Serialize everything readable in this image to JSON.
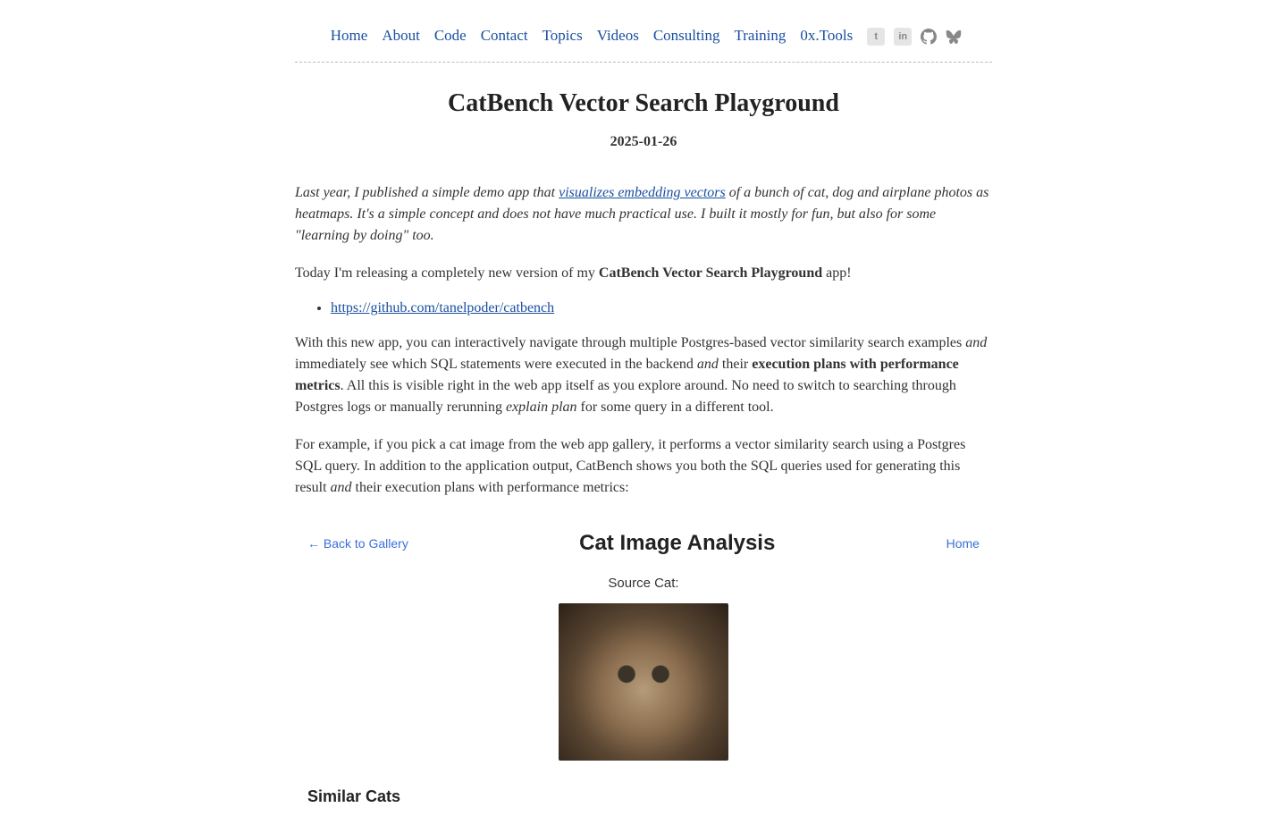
{
  "nav": {
    "items": [
      "Home",
      "About",
      "Code",
      "Contact",
      "Topics",
      "Videos",
      "Consulting",
      "Training",
      "0x.Tools"
    ]
  },
  "article": {
    "title": "CatBench Vector Search Playground",
    "date": "2025-01-26",
    "intro_pre": "Last year, I published a simple demo app that ",
    "intro_link": "visualizes embedding vectors",
    "intro_post": " of a bunch of cat, dog and airplane photos as heatmaps. It's a simple concept and does not have much practical use. I built it mostly for fun, but also for some \"learning by doing\" too.",
    "p2_pre": "Today I'm releasing a completely new version of my ",
    "p2_strong": "CatBench Vector Search Playground",
    "p2_post": " app!",
    "repo_link": "https://github.com/tanelpoder/catbench",
    "p3_a": "With this new app, you can interactively navigate through multiple Postgres-based vector similarity search examples ",
    "p3_b": "and",
    "p3_c": " immediately see which SQL statements were executed in the backend ",
    "p3_d": "and",
    "p3_e": " their ",
    "p3_f": "execution plans with performance metrics",
    "p3_g": ". All this is visible right in the web app itself as you explore around. No need to switch to searching through Postgres logs or manually rerunning ",
    "p3_h": "explain plan",
    "p3_i": " for some query in a different tool.",
    "p4_a": "For example, if you pick a cat image from the web app gallery, it performs a vector similarity search using a Postgres SQL query. In addition to the application output, CatBench shows you both the SQL queries used for generating this result ",
    "p4_b": "and",
    "p4_c": " their execution plans with performance metrics:"
  },
  "embed": {
    "back": "← Back to Gallery",
    "title": "Cat Image Analysis",
    "home": "Home",
    "source": "Source Cat:",
    "similar": "Similar Cats"
  }
}
